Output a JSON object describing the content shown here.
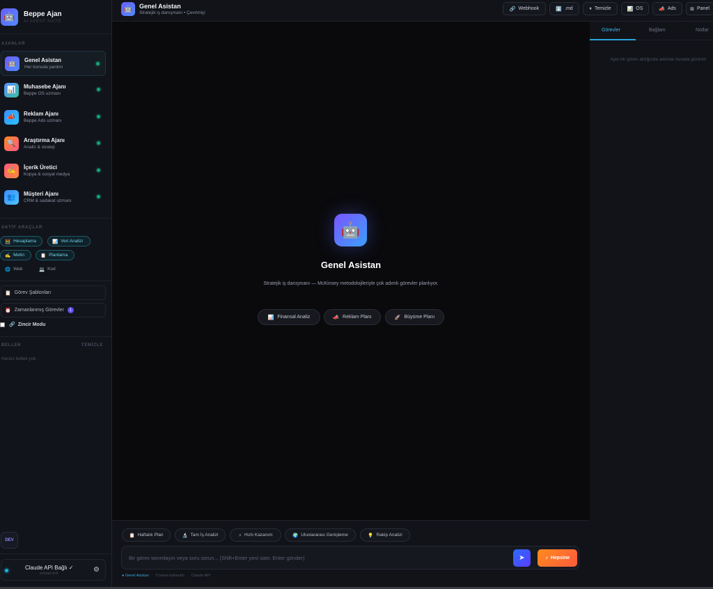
{
  "brand": {
    "name": "Beppe Ajan",
    "subtitle": "AI AGENT SUITE",
    "icon": "robot-icon"
  },
  "sidebar": {
    "agents_label": "AJANLAR",
    "agents": [
      {
        "name": "Genel Asistan",
        "desc": "Her konuda yardım",
        "icon": "🤖",
        "icon_name": "robot-icon",
        "color": "#5b63f0",
        "active": true
      },
      {
        "name": "Muhasebe Ajanı",
        "desc": "Beppe OS uzmanı",
        "icon": "📊",
        "icon_name": "chart-icon",
        "color": "#3b82f6"
      },
      {
        "name": "Reklam Ajanı",
        "desc": "Beppe Ads uzmanı",
        "icon": "📣",
        "icon_name": "megaphone-icon",
        "color": "#3b82f6"
      },
      {
        "name": "Araştırma Ajanı",
        "desc": "Analiz & strateji",
        "icon": "🔍",
        "icon_name": "magnifier-icon",
        "color": "#f97316"
      },
      {
        "name": "İçerik Üretici",
        "desc": "Kopya & sosyal medya",
        "icon": "✍️",
        "icon_name": "writing-hand-icon",
        "color": "#f43f5e"
      },
      {
        "name": "Müşteri Ajanı",
        "desc": "CRM & sadakat uzmanı",
        "icon": "👥",
        "icon_name": "people-icon",
        "color": "#3b82f6"
      }
    ],
    "tools_label": "AKTİF ARAÇLAR",
    "tools": [
      {
        "label": "Hesaplama",
        "icon": "🧮",
        "active": true
      },
      {
        "label": "Veri Analizi",
        "icon": "📊",
        "active": true
      },
      {
        "label": "Metin",
        "icon": "✍️",
        "active": true
      },
      {
        "label": "Planlama",
        "icon": "📋",
        "active": true
      },
      {
        "label": "Web",
        "icon": "🌐",
        "active": false
      },
      {
        "label": "Kod",
        "icon": "💻",
        "active": false
      }
    ],
    "templates_button": "Görev Şablonları",
    "scheduled_button": "Zamanlanmış Görevler",
    "scheduled_count": "1",
    "chain_mode": "Zincir Modu",
    "memory_label": "BELLEK",
    "memory_clear": "TEMİZLE",
    "memory_empty": "Henüz bellek yok",
    "dev_button": "DEV",
    "api_status": "Claude API Bağlı ✓",
    "api_model": "sonnet-4-6"
  },
  "topbar": {
    "title": "Genel Asistan",
    "subtitle": "Stratejik iş danışmanı • Çevrimiçi",
    "buttons": [
      {
        "label": "Webhook",
        "icon": "🔗"
      },
      {
        "label": ".md",
        "icon": "⬇️"
      },
      {
        "label": "Temizle",
        "icon": "⏸"
      },
      {
        "label": "OS",
        "icon": "📊"
      },
      {
        "label": "Ads",
        "icon": "📣"
      },
      {
        "label": "Panel",
        "icon": "⊞"
      }
    ]
  },
  "hero": {
    "title": "Genel Asistan",
    "description": "Stratejik iş danışmanı — McKinsey metodolojileriyle çok adımlı görevler planlıyor.",
    "chips": [
      {
        "label": "Finansal Analiz",
        "icon": "📊"
      },
      {
        "label": "Reklam Planı",
        "icon": "📣"
      },
      {
        "label": "Büyüme Planı",
        "icon": "🚀"
      }
    ]
  },
  "composer": {
    "quick_chips": [
      {
        "label": "Haftalık Plan",
        "icon": "📋"
      },
      {
        "label": "Tam İş Analizi",
        "icon": "🔬"
      },
      {
        "label": "Hızlı Kazanım",
        "icon": "⚡"
      },
      {
        "label": "Uluslararası Genişleme",
        "icon": "🌍"
      },
      {
        "label": "Rakip Analizi",
        "icon": "💡"
      }
    ],
    "placeholder": "Bir görev tanımlayın veya soru sorun... (Shift+Enter yeni satır, Enter gönder)",
    "send_icon": "➤",
    "all_button": "Hepsine",
    "all_icon": "⚡",
    "footer_agent": "● Genel Asistan",
    "footer_tokens": "0 token kullanıldı",
    "footer_api": "Claude API"
  },
  "right_panel": {
    "tabs": [
      "Görevler",
      "Bağlam",
      "Notlar"
    ],
    "empty": "Ajan bir görev aldığında adımlar burada görünür"
  }
}
